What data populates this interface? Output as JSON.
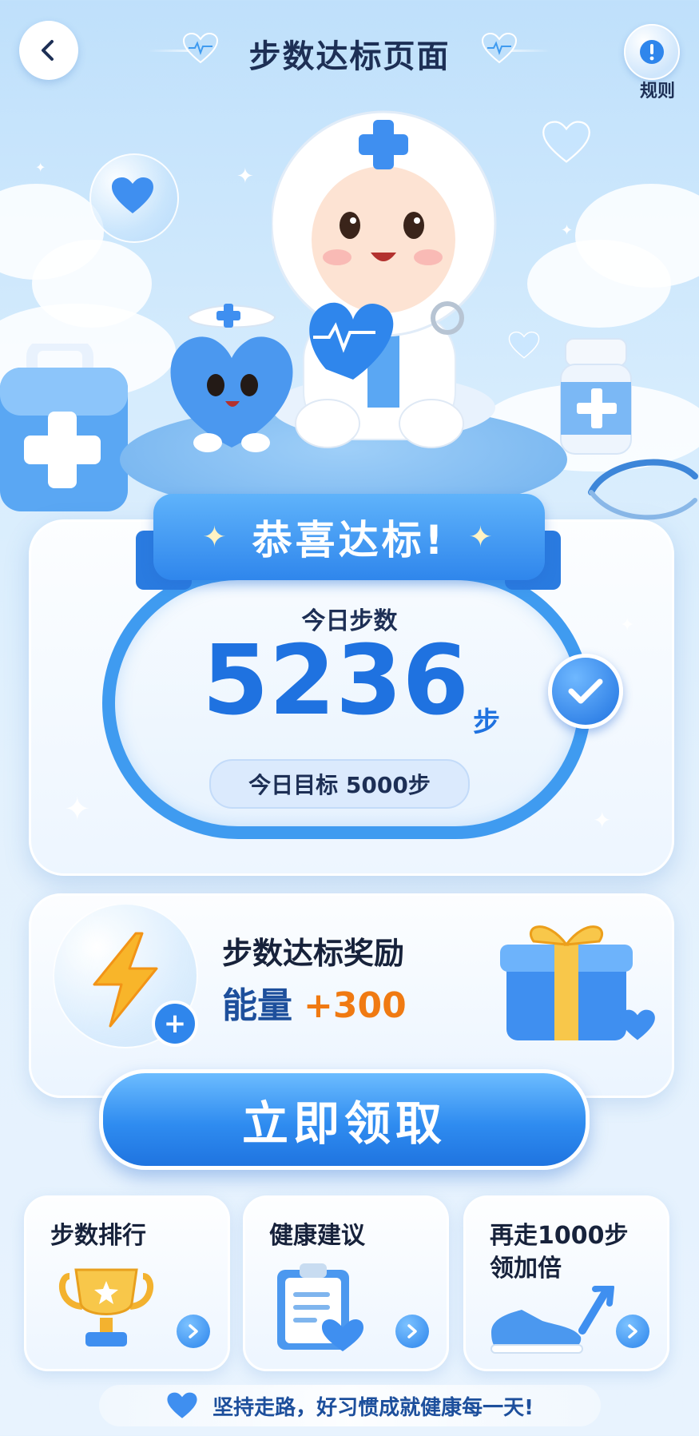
{
  "header": {
    "title": "步数达标页面",
    "rules_label": "规则"
  },
  "congrats": {
    "banner": "恭喜达标!",
    "steps_label": "今日步数",
    "steps_value": "5236",
    "steps_unit": "步",
    "goal_text": "今日目标 5000步"
  },
  "reward": {
    "title": "步数达标奖励",
    "energy_label": "能量",
    "energy_amount": "+300"
  },
  "claim_button": "立即领取",
  "cards": [
    {
      "title": "步数排行"
    },
    {
      "title": "健康建议"
    },
    {
      "title": "再走1000步\n领加倍"
    }
  ],
  "footer": "坚持走路，好习惯成就健康每一天!",
  "colors": {
    "accent": "#2f86ec",
    "reward_orange": "#f07a12",
    "text_dark": "#17223b"
  },
  "icons": [
    "back-icon",
    "rules-icon",
    "check-icon",
    "lightning-icon",
    "gift-icon",
    "trophy-icon",
    "clipboard-icon",
    "shoe-icon",
    "heart-icon"
  ]
}
